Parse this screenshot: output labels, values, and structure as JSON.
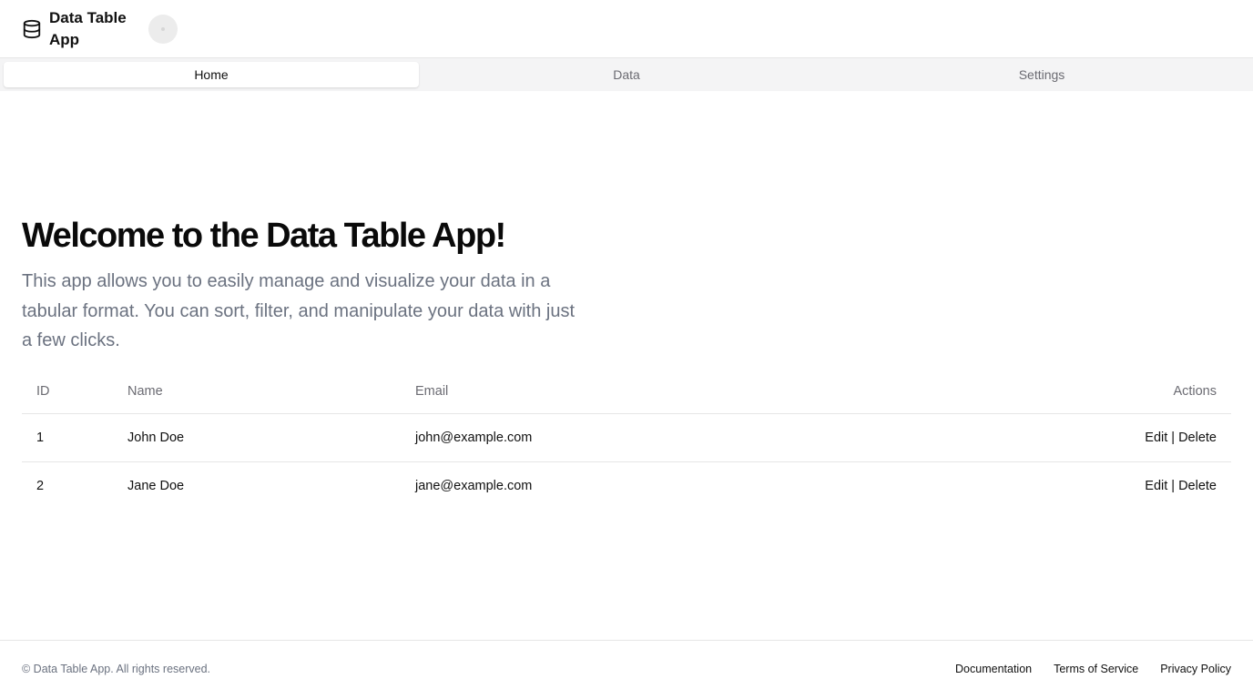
{
  "header": {
    "app_title": "Data Table App",
    "brand_icon": "database-icon"
  },
  "tabs": [
    {
      "label": "Home",
      "active": true
    },
    {
      "label": "Data",
      "active": false
    },
    {
      "label": "Settings",
      "active": false
    }
  ],
  "main": {
    "title": "Welcome to the Data Table App!",
    "description": "This app allows you to easily manage and visualize your data in a tabular format. You can sort, filter, and manipulate your data with just a few clicks."
  },
  "table": {
    "columns": [
      "ID",
      "Name",
      "Email",
      "Actions"
    ],
    "rows": [
      {
        "id": "1",
        "name": "John Doe",
        "email": "john@example.com",
        "edit": "Edit",
        "separator": "|",
        "delete": "Delete"
      },
      {
        "id": "2",
        "name": "Jane Doe",
        "email": "jane@example.com",
        "edit": "Edit",
        "separator": "|",
        "delete": "Delete"
      }
    ]
  },
  "footer": {
    "copyright": "© Data Table App. All rights reserved.",
    "links": [
      "Documentation",
      "Terms of Service",
      "Privacy Policy"
    ]
  },
  "colors": {
    "text_primary": "#111111",
    "text_muted": "#6b7280",
    "tab_bg": "#f4f4f5",
    "border": "#e6e6e6"
  }
}
